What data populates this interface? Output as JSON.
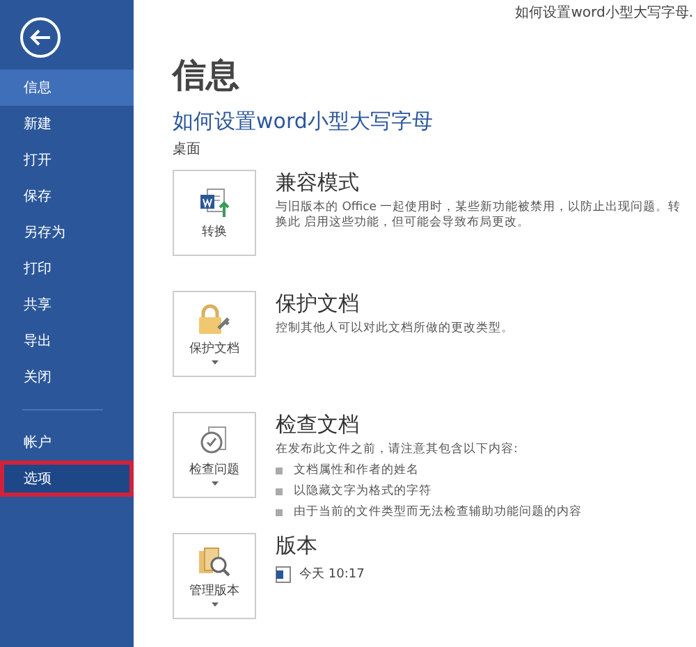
{
  "window": {
    "title": "如何设置word小型大写字母."
  },
  "sidebar": {
    "items": [
      {
        "label": "信息",
        "selected": true,
        "highlighted": false
      },
      {
        "label": "新建",
        "selected": false,
        "highlighted": false
      },
      {
        "label": "打开",
        "selected": false,
        "highlighted": false
      },
      {
        "label": "保存",
        "selected": false,
        "highlighted": false
      },
      {
        "label": "另存为",
        "selected": false,
        "highlighted": false
      },
      {
        "label": "打印",
        "selected": false,
        "highlighted": false
      },
      {
        "label": "共享",
        "selected": false,
        "highlighted": false
      },
      {
        "label": "导出",
        "selected": false,
        "highlighted": false
      },
      {
        "label": "关闭",
        "selected": false,
        "highlighted": false
      }
    ],
    "bottom_items": [
      {
        "label": "帐户",
        "selected": false,
        "highlighted": false
      },
      {
        "label": "选项",
        "selected": false,
        "highlighted": true
      }
    ]
  },
  "page": {
    "heading": "信息",
    "document_title": "如何设置word小型大写字母",
    "location": "桌面"
  },
  "sections": [
    {
      "kind": "convert",
      "button": "转换",
      "has_menu": false,
      "title": "兼容模式",
      "description": "与旧版本的 Office 一起使用时，某些新功能被禁用，以防止出现问题。转换此 启用这些功能，但可能会导致布局更改。"
    },
    {
      "kind": "protect",
      "button": "保护文档",
      "has_menu": true,
      "title": "保护文档",
      "description": "控制其他人可以对此文档所做的更改类型。"
    },
    {
      "kind": "inspect",
      "button": "检查问题",
      "has_menu": true,
      "title": "检查文档",
      "description": "在发布此文件之前，请注意其包含以下内容:",
      "bullets": [
        "文档属性和作者的姓名",
        "以隐藏文字为格式的字符",
        "由于当前的文件类型而无法检查辅助功能问题的内容"
      ]
    },
    {
      "kind": "versions",
      "button": "管理版本",
      "has_menu": true,
      "title": "版本",
      "versions": [
        "今天 10:17"
      ]
    }
  ]
}
